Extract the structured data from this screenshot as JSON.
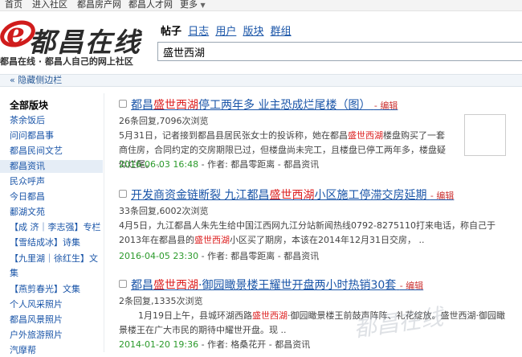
{
  "topnav": [
    {
      "label": "首页"
    },
    {
      "label": "进入社区"
    },
    {
      "label": "都昌房产网"
    },
    {
      "label": "都昌人才网"
    },
    {
      "label": "更多"
    }
  ],
  "header": {
    "logo_text": "都昌在线",
    "slogan": "都昌在线 · 都昌人自己的网上社区",
    "search_tabs": [
      {
        "label": "帖子",
        "active": true
      },
      {
        "label": "日志"
      },
      {
        "label": "用户"
      },
      {
        "label": "版块"
      },
      {
        "label": "群组"
      }
    ],
    "search_value": "盛世西湖"
  },
  "toggle_label": "« 隐藏侧边栏",
  "sidebar": {
    "title": "全部版块",
    "items": [
      {
        "label": "茶余饭后"
      },
      {
        "label": "问问都昌事"
      },
      {
        "label": "都昌民间文艺"
      },
      {
        "label": "都昌资讯",
        "active": true
      },
      {
        "label": "民众呼声"
      },
      {
        "label": "今日都昌"
      },
      {
        "label": "鄱湖文苑"
      },
      {
        "label": "【成 济｜李志强】专栏"
      },
      {
        "label": "【雪结成冰】诗集"
      },
      {
        "label": "【九里湖｜徐红生】文"
      },
      {
        "label": "集"
      },
      {
        "label": "【燕剪春光】文集"
      },
      {
        "label": "个人风采照片"
      },
      {
        "label": "都昌风景照片"
      },
      {
        "label": "户外旅游照片"
      },
      {
        "label": "汽摩帮"
      }
    ]
  },
  "posts": [
    {
      "title_pre": "都昌",
      "title_hl": "盛世西湖",
      "title_post": "停工两年多 业主恐成烂尾楼（图）",
      "edit": "- 编辑",
      "stats": "26条回复,7096次浏览",
      "summary_1": "5月31日，记者接到都昌县居民张女士的投诉称，她在都昌",
      "summary_hl": "盛世西湖",
      "summary_2": "楼盘购买了一套商住房，合同约定的交房期限已过，但楼盘尚未完工，且楼盘已停工两年多，楼盘疑似烂尾。 ..",
      "date": "2016-06-03 16:48",
      "meta": " - 作者: 都昌零距离 - 都昌资讯"
    },
    {
      "title_pre": "开发商资金链断裂 九江都昌",
      "title_hl": "盛世西湖",
      "title_post": "小区施工停滞交房延期",
      "edit": "- 编辑",
      "stats": "33条回复,6002次浏览",
      "summary_1": "4月5日，九江都昌人朱先生给中国江西网九江分站新闻热线0792-8275110打来电话，称自己于2013年在都昌县的",
      "summary_hl": "盛世西湖",
      "summary_2": "小区买了期房，本该在2014年12月31日交房， ..",
      "date": "2016-04-05 23:30",
      "meta": " - 作者: 都昌零距离 - 都昌资讯"
    },
    {
      "title_pre": "都昌",
      "title_hl": "盛世西湖",
      "title_post": "·御园瞰景楼王耀世开盘两小时热销30套",
      "edit": "- 编辑",
      "stats": "2条回复,1335次浏览",
      "summary_1": "1月19日上午，县城环湖西路",
      "summary_hl": "盛世西湖",
      "summary_2": "·御园瞰景楼王前鼓声阵阵、礼花绽放。盛世西湖·御园瞰景楼王在广大市民的期待中耀世开盘。现 ..",
      "date": "2014-01-20 19:36",
      "meta": " - 作者: 格桑花开 - 都昌资讯"
    }
  ],
  "watermark": "都昌在线"
}
